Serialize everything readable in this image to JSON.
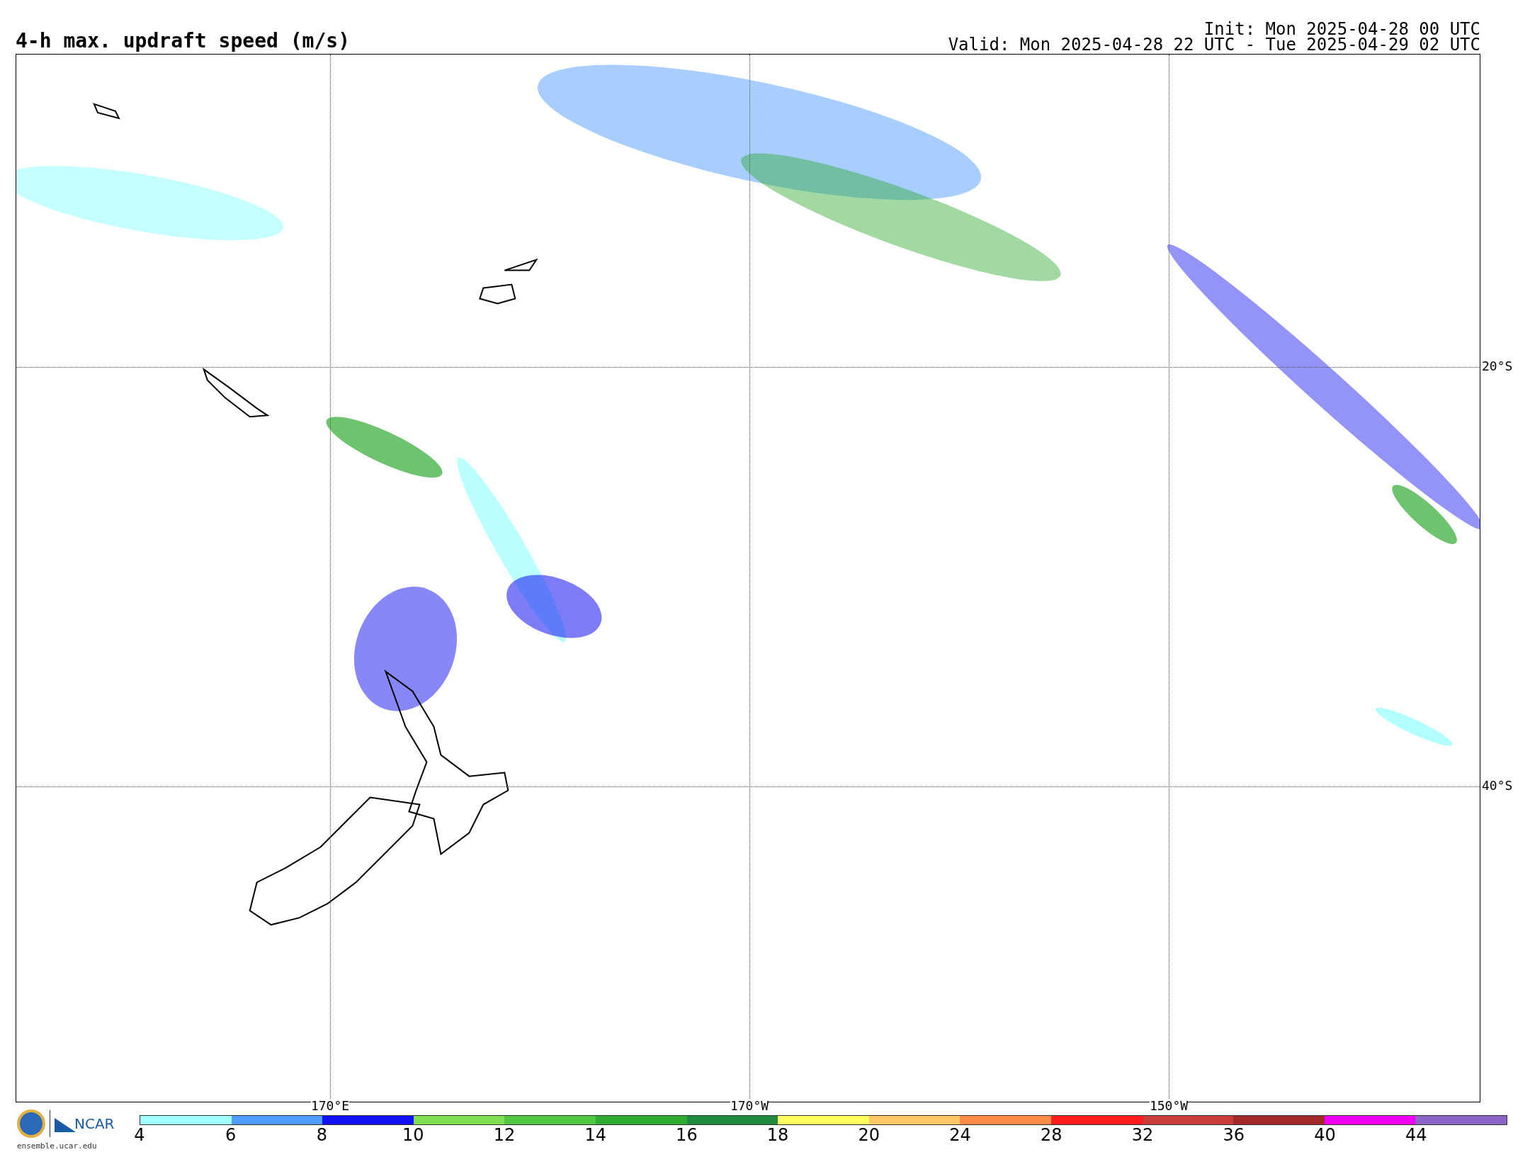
{
  "title": "4-h max. updraft speed (m/s)",
  "init": "Init: Mon 2025-04-28 00 UTC",
  "valid": "Valid: Mon 2025-04-28 22 UTC - Tue 2025-04-29 02 UTC",
  "map": {
    "latitude_labels": [
      "20°S",
      "40°S"
    ],
    "longitude_labels": [
      "170°E",
      "170°W",
      "150°W"
    ]
  },
  "logos": {
    "ncar": "NCAR",
    "url": "ensemble.ucar.edu"
  },
  "legend": {
    "bins": [
      {
        "label": "4",
        "color": "#a0ffff"
      },
      {
        "label": "6",
        "color": "#4f9dff"
      },
      {
        "label": "8",
        "color": "#1010f0"
      },
      {
        "label": "10",
        "color": "#7ee050"
      },
      {
        "label": "12",
        "color": "#50c840"
      },
      {
        "label": "14",
        "color": "#30aa30"
      },
      {
        "label": "16",
        "color": "#1e8c3c"
      },
      {
        "label": "18",
        "color": "#ffff60"
      },
      {
        "label": "20",
        "color": "#ffc864"
      },
      {
        "label": "24",
        "color": "#ff8c46"
      },
      {
        "label": "28",
        "color": "#ff1e1e"
      },
      {
        "label": "32",
        "color": "#c83c3c"
      },
      {
        "label": "36",
        "color": "#a02828"
      },
      {
        "label": "40",
        "color": "#f000f0"
      },
      {
        "label": "44",
        "color": "#8c64c8"
      }
    ]
  }
}
